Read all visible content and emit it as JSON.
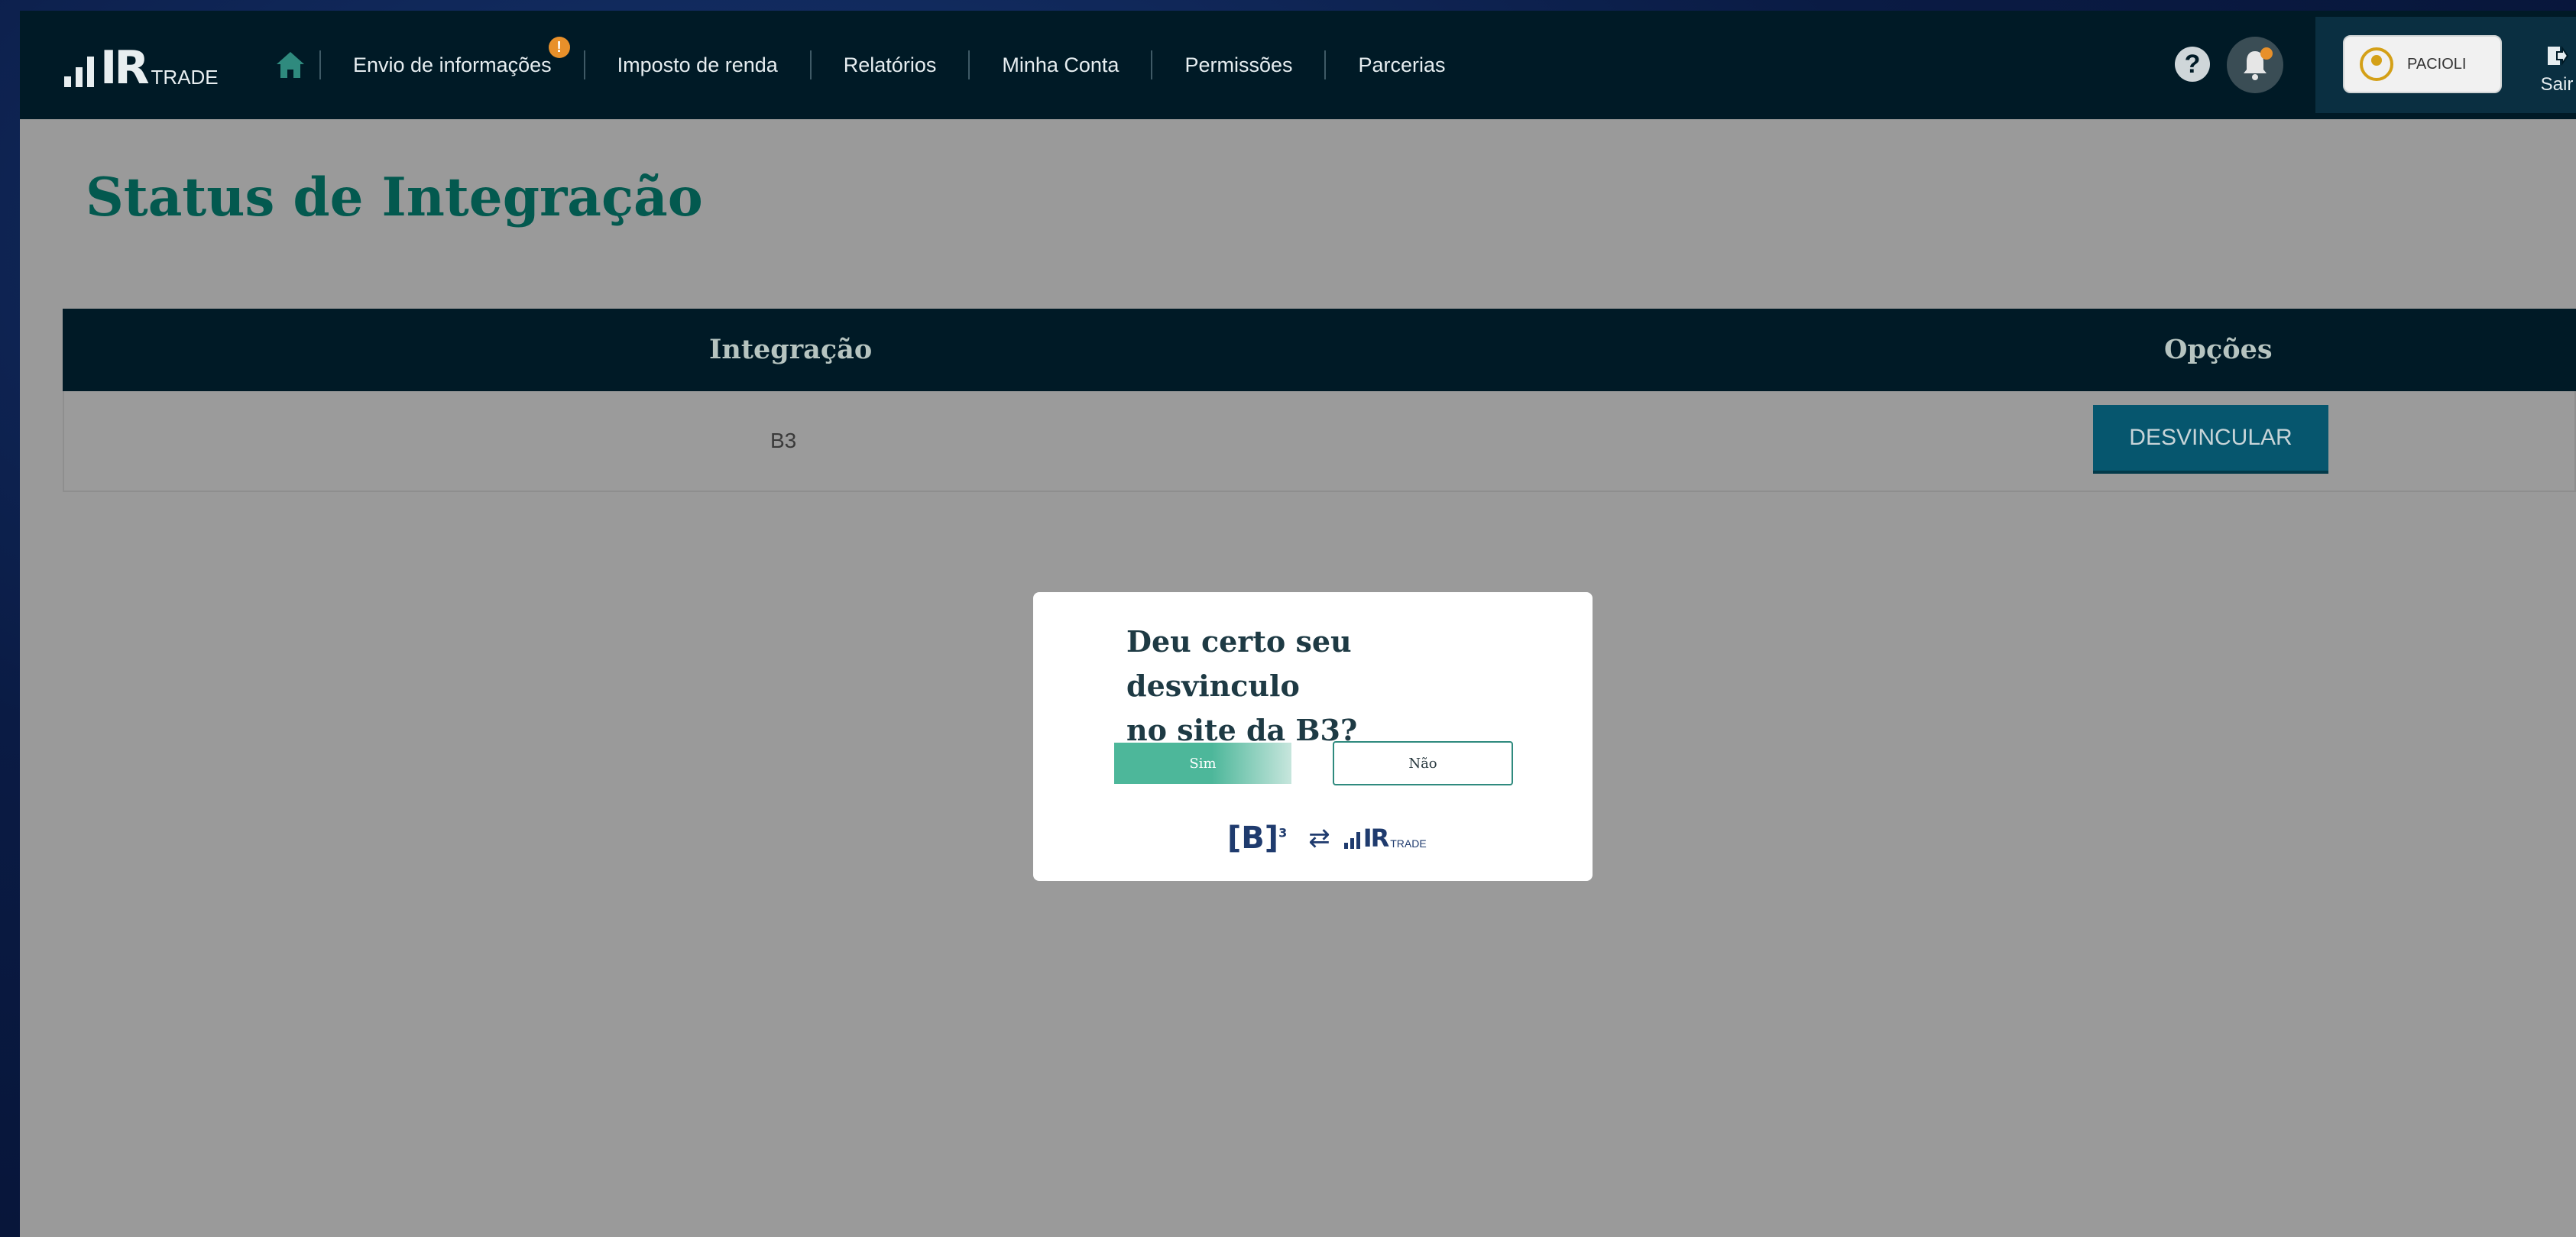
{
  "brand": {
    "logo_mark": "IR",
    "logo_text": "TRADE"
  },
  "nav": {
    "items": [
      {
        "label": "Envio de informações",
        "badge": "!"
      },
      {
        "label": "Imposto de renda"
      },
      {
        "label": "Relatórios"
      },
      {
        "label": "Minha Conta"
      },
      {
        "label": "Permissões"
      },
      {
        "label": "Parcerias"
      }
    ],
    "help_label": "?",
    "user_name": "PACIOLI",
    "logout_label": "Sair"
  },
  "page": {
    "title": "Status de Integração"
  },
  "table": {
    "headers": [
      "Integração",
      "Opções"
    ],
    "rows": [
      {
        "integration": "B3",
        "action": "DESVINCULAR"
      }
    ]
  },
  "modal": {
    "question_line1": "Deu certo seu desvinculo",
    "question_line2": "no site da B3?",
    "yes_label": "Sim",
    "no_label": "Não",
    "b3_logo": "[B]",
    "b3_sup": "3",
    "swap_symbol": "⇄"
  },
  "colors": {
    "navbar": "#001a26",
    "title": "#03594f",
    "primary_button": "#06566e",
    "yes_button": "#4db79a",
    "badge": "#e8902a"
  },
  "icons": [
    "home-icon",
    "help-icon",
    "bell-icon",
    "avatar-icon",
    "logout-icon",
    "swap-icon"
  ]
}
